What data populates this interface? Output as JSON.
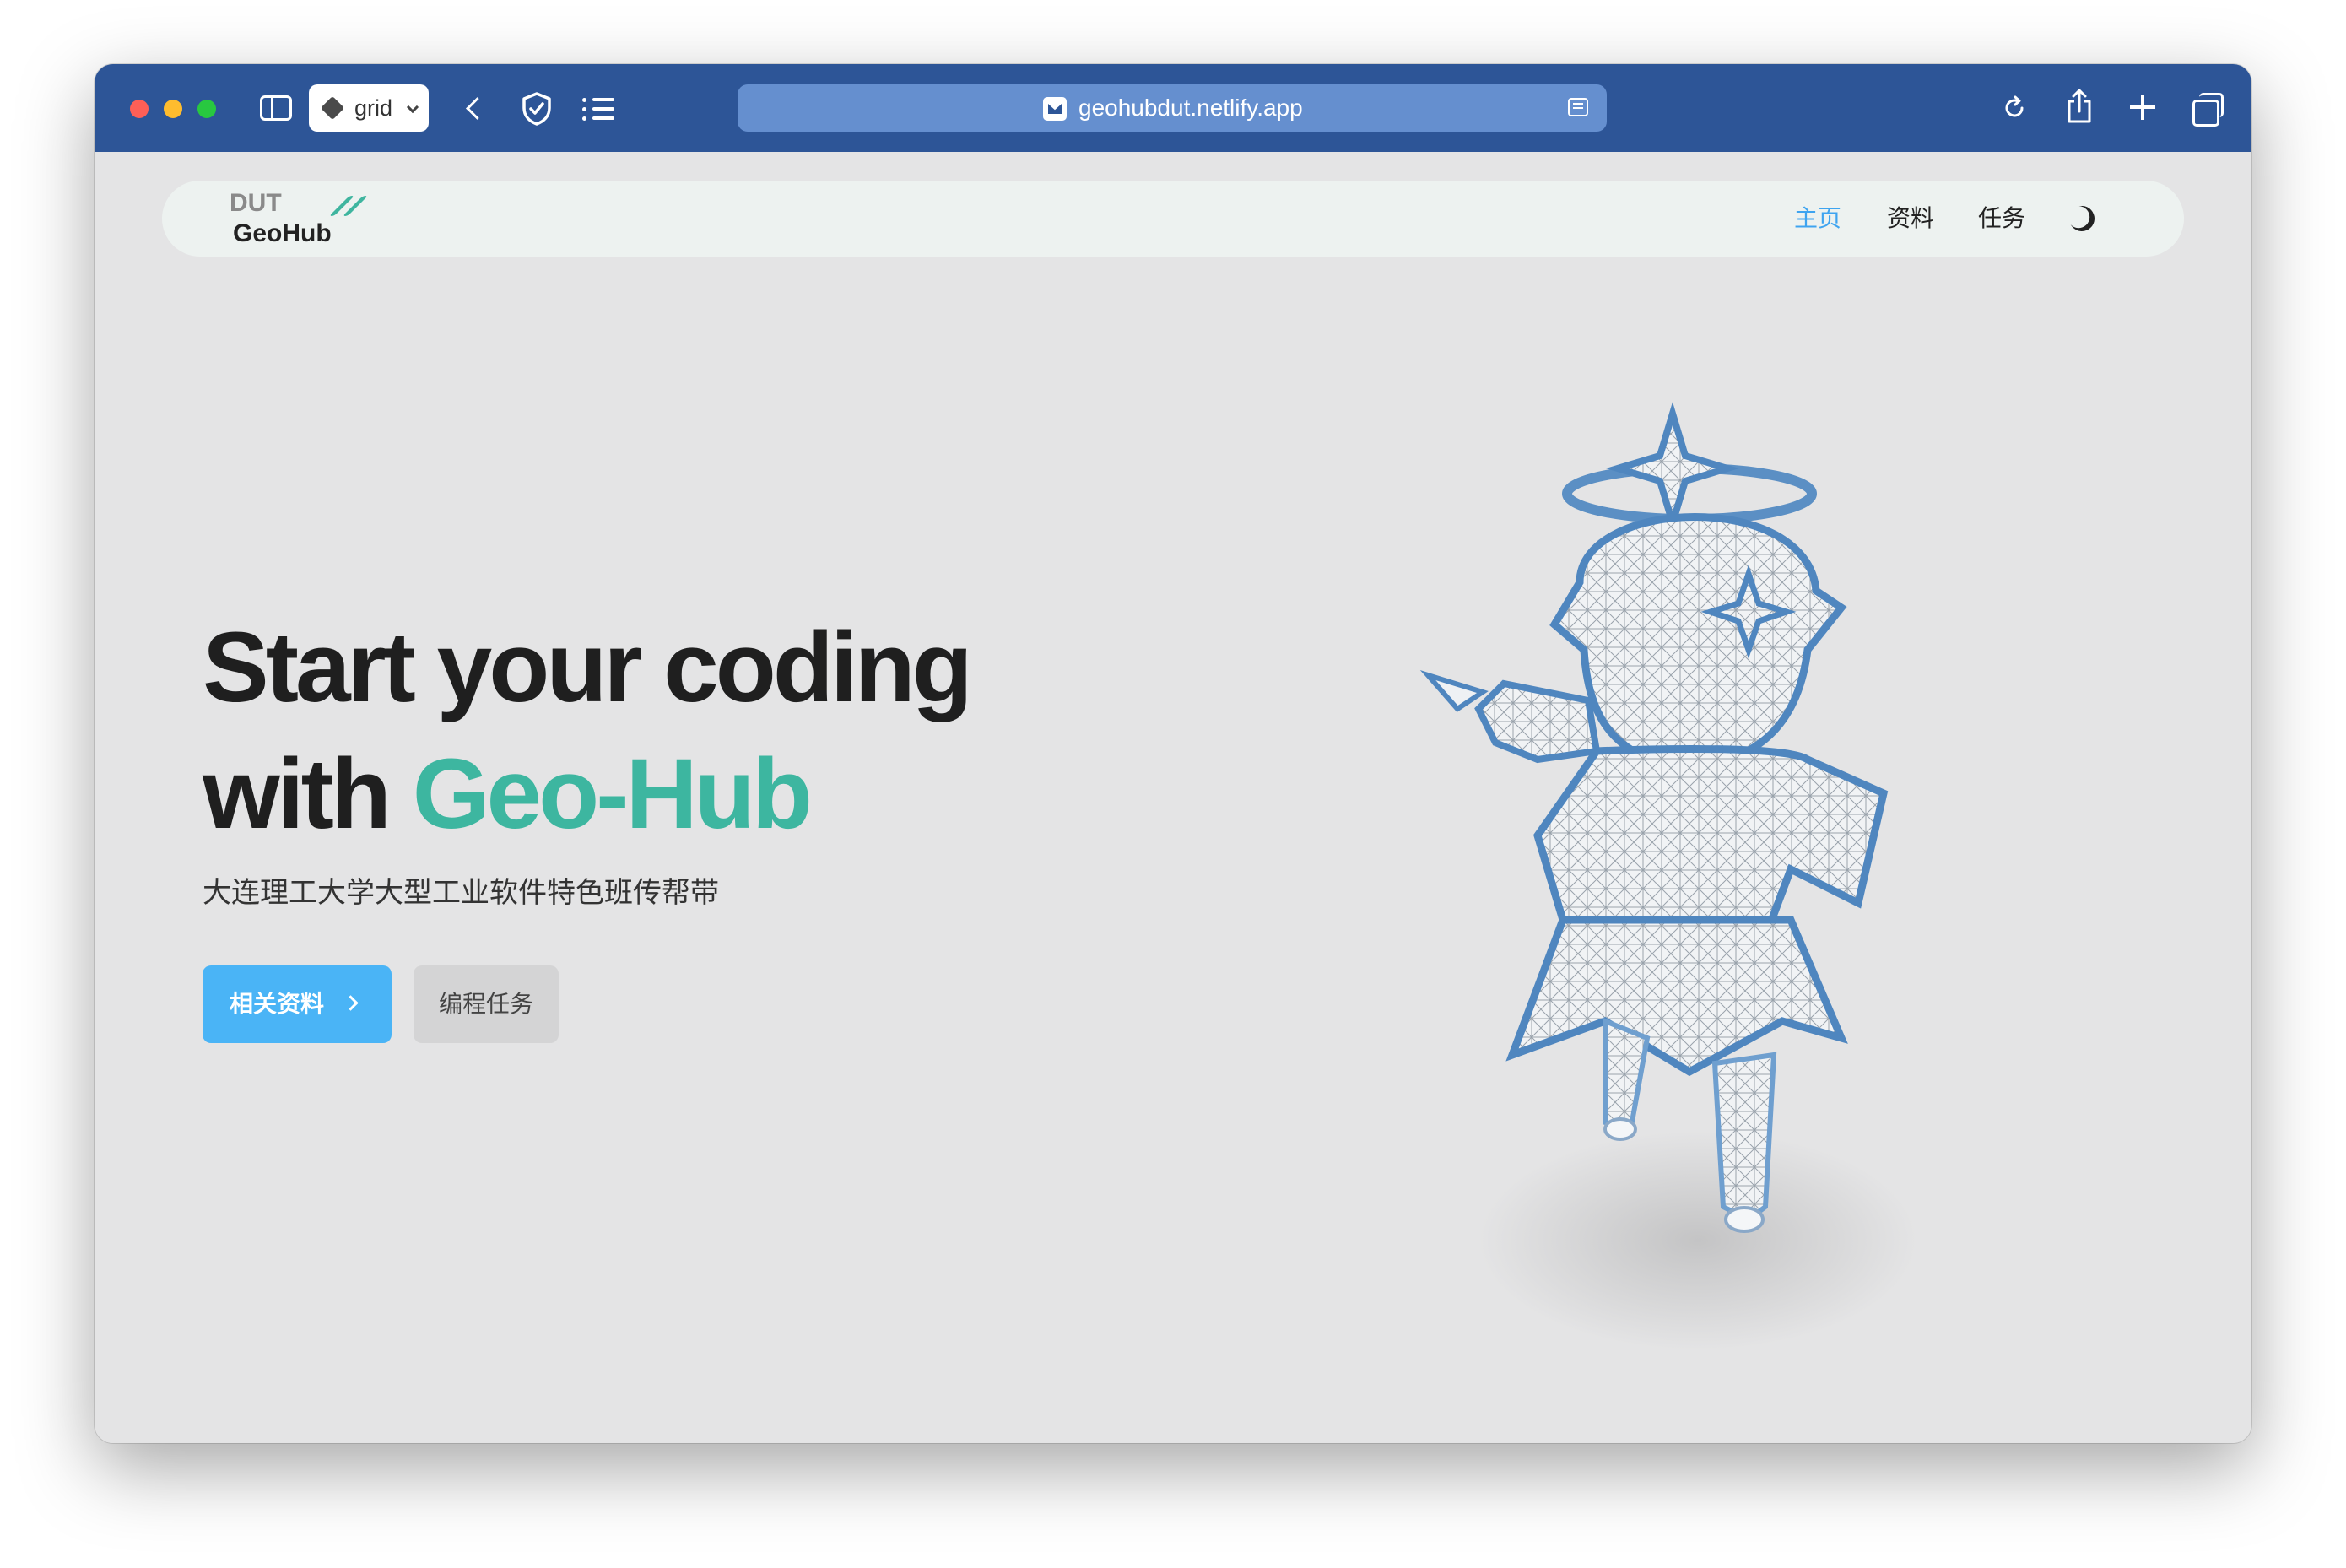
{
  "browser": {
    "tab_group_label": "grid",
    "url": "geohubdut.netlify.app"
  },
  "nav": {
    "logo_top": "DUT",
    "logo_bottom": "GeoHub",
    "items": [
      {
        "label": "主页"
      },
      {
        "label": "资料"
      },
      {
        "label": "任务"
      }
    ]
  },
  "hero": {
    "title_line1": "Start your coding",
    "title_line2_prefix": "with ",
    "title_accent": "Geo-Hub",
    "subtitle": "大连理工大学大型工业软件特色班传帮带",
    "primary_button": "相关资料",
    "secondary_button": "编程任务"
  },
  "colors": {
    "toolbar": "#2d5597",
    "accent_green": "#3db6a0",
    "accent_blue": "#4ab4f6",
    "page_bg": "#e4e4e5"
  }
}
